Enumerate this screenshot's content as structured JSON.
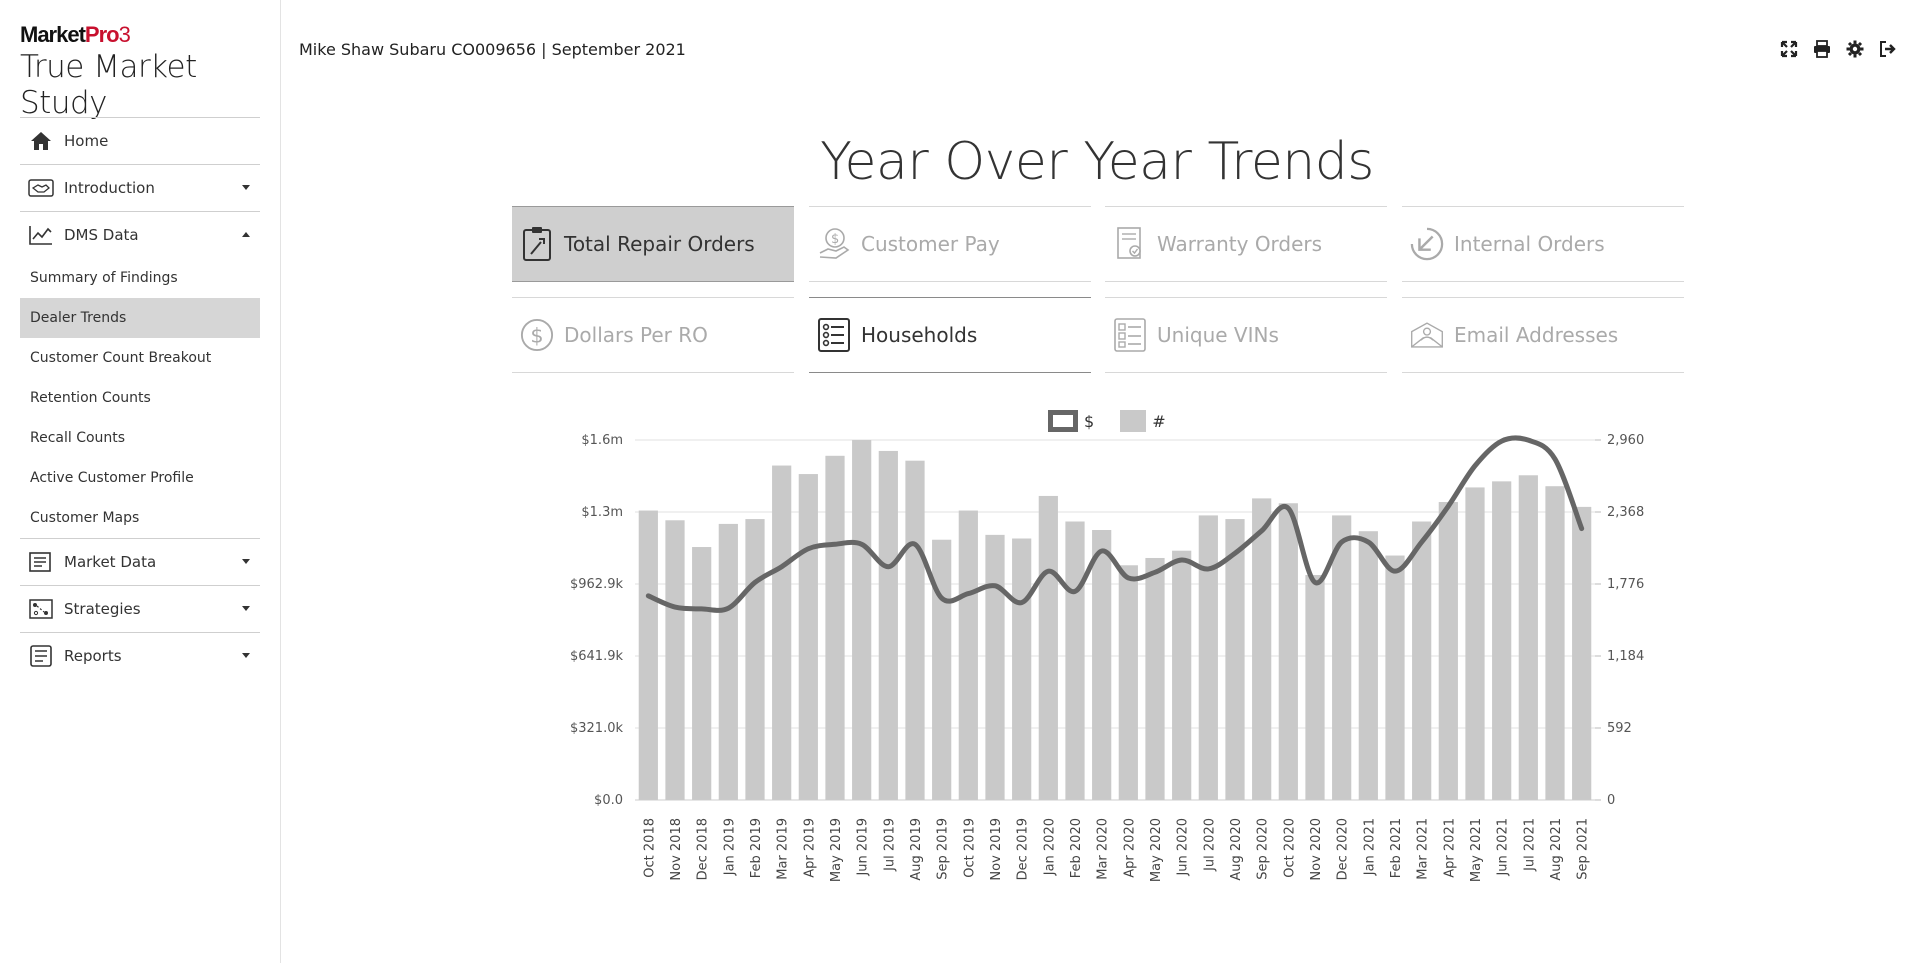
{
  "app": {
    "brand_market": "Market",
    "brand_pro": "Pro",
    "brand_ver": "3",
    "subtitle": "True Market Study"
  },
  "header": {
    "title": "Mike Shaw Subaru CO009656 | September 2021"
  },
  "sidebar": {
    "items": [
      {
        "label": "Home",
        "icon": "home-icon"
      },
      {
        "label": "Introduction",
        "icon": "handshake-icon"
      },
      {
        "label": "DMS Data",
        "icon": "trend-chart-icon"
      },
      {
        "label": "Market Data",
        "icon": "newspaper-icon"
      },
      {
        "label": "Strategies",
        "icon": "strategy-icon"
      },
      {
        "label": "Reports",
        "icon": "report-icon"
      }
    ],
    "dms_sub": [
      {
        "label": "Summary of Findings"
      },
      {
        "label": "Dealer Trends",
        "active": true
      },
      {
        "label": "Customer Count Breakout"
      },
      {
        "label": "Retention Counts"
      },
      {
        "label": "Recall Counts"
      },
      {
        "label": "Active Customer Profile"
      },
      {
        "label": "Customer Maps"
      }
    ]
  },
  "main": {
    "title": "Year Over Year Trends",
    "tiles": [
      {
        "label": "Total Repair Orders",
        "icon": "clipboard-wrench-icon"
      },
      {
        "label": "Customer Pay",
        "icon": "hand-dollar-icon"
      },
      {
        "label": "Warranty Orders",
        "icon": "certificate-icon"
      },
      {
        "label": "Internal Orders",
        "icon": "arrow-down-left-icon"
      },
      {
        "label": "Dollars Per RO",
        "icon": "dollar-circle-icon"
      },
      {
        "label": "Households",
        "icon": "list-icon"
      },
      {
        "label": "Unique VINs",
        "icon": "vin-list-icon"
      },
      {
        "label": "Email Addresses",
        "icon": "envelope-person-icon"
      }
    ]
  },
  "colors": {
    "bar": "#c9c9c9",
    "line": "#666666",
    "selected_tile": "#cfcfcf",
    "brand_red": "#c8102e"
  },
  "chart_data": {
    "type": "bar",
    "legend": [
      "$",
      "#"
    ],
    "legend_position": "top-center",
    "grid": true,
    "categories": [
      "Oct 2018",
      "Nov 2018",
      "Dec 2018",
      "Jan 2019",
      "Feb 2019",
      "Mar 2019",
      "Apr 2019",
      "May 2019",
      "Jun 2019",
      "Jul 2019",
      "Aug 2019",
      "Sep 2019",
      "Oct 2019",
      "Nov 2019",
      "Dec 2019",
      "Jan 2020",
      "Feb 2020",
      "Mar 2020",
      "Apr 2020",
      "May 2020",
      "Jun 2020",
      "Jul 2020",
      "Aug 2020",
      "Sep 2020",
      "Oct 2020",
      "Nov 2020",
      "Dec 2020",
      "Jan 2021",
      "Feb 2021",
      "Mar 2021",
      "Apr 2021",
      "May 2021",
      "Jun 2021",
      "Jul 2021",
      "Aug 2021",
      "Sep 2021"
    ],
    "left_axis": {
      "ticks": [
        "$0.0",
        "$321.0k",
        "$641.9k",
        "$962.9k",
        "$1.3m",
        "$1.6m"
      ],
      "ylim": [
        0,
        1604800
      ]
    },
    "right_axis": {
      "ticks": [
        "0",
        "592",
        "1,184",
        "1,776",
        "2,368",
        "2,960"
      ],
      "ylim": [
        0,
        2960
      ]
    },
    "series": [
      {
        "name": "#",
        "type": "bar",
        "axis": "right",
        "values": [
          2380,
          2300,
          2080,
          2270,
          2310,
          2750,
          2680,
          2830,
          2960,
          2870,
          2790,
          2140,
          2380,
          2180,
          2150,
          2500,
          2290,
          2220,
          1930,
          1990,
          2050,
          2340,
          2310,
          2480,
          2440,
          1850,
          2340,
          2210,
          2010,
          2290,
          2450,
          2570,
          2620,
          2670,
          2580,
          2410
        ]
      },
      {
        "name": "$",
        "type": "line",
        "axis": "left",
        "values": [
          910000,
          860000,
          852000,
          855000,
          970000,
          1040000,
          1120000,
          1140000,
          1140000,
          1040000,
          1140000,
          900000,
          920000,
          955000,
          880000,
          1020000,
          930000,
          1110000,
          990000,
          1015000,
          1070000,
          1030000,
          1100000,
          1200000,
          1300000,
          970000,
          1150000,
          1150000,
          1020000,
          1150000,
          1310000,
          1490000,
          1600000,
          1604000,
          1520000,
          1210000
        ]
      }
    ]
  }
}
